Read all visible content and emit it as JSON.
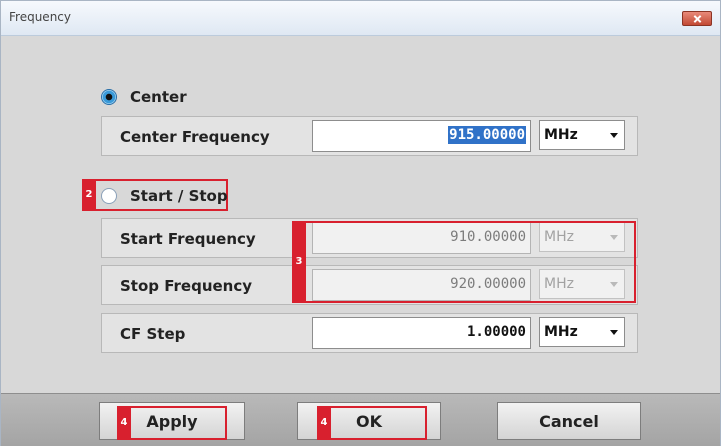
{
  "window": {
    "title": "Frequency",
    "close_icon": "close-icon"
  },
  "center": {
    "radio_label": "Center",
    "selected": true,
    "field_label": "Center Frequency",
    "value": "915.00000",
    "unit": "MHz"
  },
  "start_stop": {
    "radio_label": "Start / Stop",
    "selected": false,
    "badge": "2",
    "range_badge": "3",
    "start": {
      "field_label": "Start Frequency",
      "value": "910.00000",
      "unit": "MHz"
    },
    "stop": {
      "field_label": "Stop Frequency",
      "value": "920.00000",
      "unit": "MHz"
    }
  },
  "cf_step": {
    "field_label": "CF Step",
    "value": "1.00000",
    "unit": "MHz"
  },
  "buttons": {
    "apply": {
      "label": "Apply",
      "badge": "4"
    },
    "ok": {
      "label": "OK",
      "badge": "4"
    },
    "cancel": {
      "label": "Cancel"
    }
  },
  "colors": {
    "annotation": "#d8202e",
    "selection": "#3072c8",
    "radio_accent": "#3a9ad9"
  }
}
